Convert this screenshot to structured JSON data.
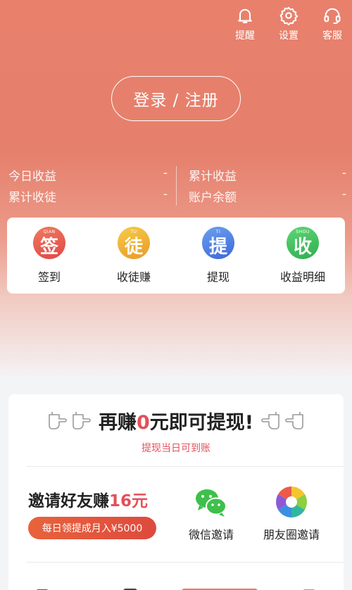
{
  "header": {
    "actions": [
      {
        "label": "提醒",
        "icon": "bell-icon"
      },
      {
        "label": "设置",
        "icon": "gear-icon"
      },
      {
        "label": "客服",
        "icon": "headset-icon"
      }
    ],
    "login_label": "登录 / 注册"
  },
  "stats": {
    "today_earnings": {
      "label": "今日收益",
      "value": "-"
    },
    "total_earnings": {
      "label": "累计收益",
      "value": "-"
    },
    "total_apprentices": {
      "label": "累计收徒",
      "value": "-"
    },
    "balance": {
      "label": "账户余额",
      "value": "-"
    }
  },
  "quick": [
    {
      "label": "签到",
      "char": "签",
      "pinyin": "QIAN",
      "color": "#e5574c"
    },
    {
      "label": "收徒赚",
      "char": "徒",
      "pinyin": "TU",
      "color": "#ebb12e"
    },
    {
      "label": "提现",
      "char": "提",
      "pinyin": "TI",
      "color": "#4c7fe0"
    },
    {
      "label": "收益明细",
      "char": "收",
      "pinyin": "SHOU",
      "color": "#3bbf5c"
    }
  ],
  "promo": {
    "title_prefix": "再赚",
    "title_amount": "0",
    "title_suffix": "元即可提现!",
    "subtitle": "提现当日可到账"
  },
  "invite": {
    "title_prefix": "邀请好友赚",
    "title_amount": "16元",
    "badge": "每日领提成月入¥5000",
    "wechat_label": "微信邀请",
    "moments_label": "朋友圈邀请"
  },
  "colors": {
    "accent": "#e8806c",
    "red": "#e4505a",
    "wechat": "#3fbf4c"
  }
}
